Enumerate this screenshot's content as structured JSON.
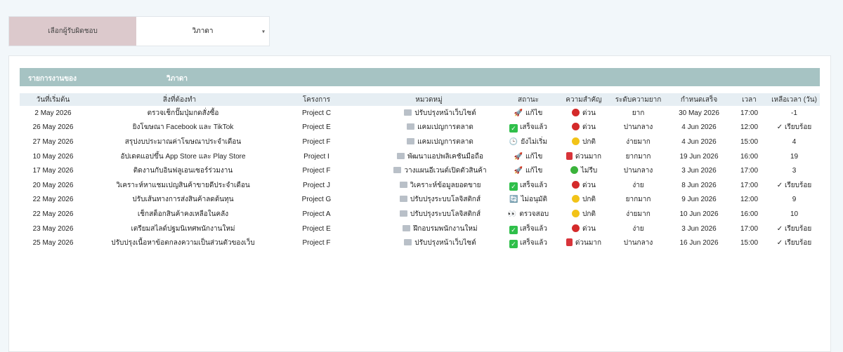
{
  "selector": {
    "label": "เลือกผู้รับผิดชอบ",
    "value": "วิภาดา",
    "caret": "▾"
  },
  "header": {
    "title": "รายการงานของ",
    "name": "วิภาดา",
    "background": "#a6c3c3"
  },
  "columns": {
    "start": "วันที่เริ่มต้น",
    "task": "สิ่งที่ต้องทำ",
    "project": "โครงการ",
    "category": "หมวดหมู่",
    "status": "สถานะ",
    "priority": "ความสำคัญ",
    "difficulty": "ระดับความยาก",
    "due": "กำหนดเสร็จ",
    "time": "เวลา",
    "remaining": "เหลือเวลา (วัน)"
  },
  "rows": [
    {
      "start": "2 May 2026",
      "task": "ตรวจเช็กปั๊มปุ่มกดสั่งซื้อ",
      "project": "Project C",
      "category": "ปรับปรุงหน้าเว็บไซต์",
      "status_icon": "🚀",
      "status": "แก้ไข",
      "priority_icon": "red-circle",
      "priority": "ด่วน",
      "difficulty": "ยาก",
      "due": "30 May 2026",
      "time": "17:00",
      "remaining": "-1"
    },
    {
      "start": "26 May 2026",
      "task": "ยิงโฆษณา Facebook และ TikTok",
      "project": "Project E",
      "category": "แคมเปญการตลาด",
      "status_icon": "check",
      "status": "เสร็จแล้ว",
      "priority_icon": "red-circle",
      "priority": "ด่วน",
      "difficulty": "ปานกลาง",
      "due": "4 Jun 2026",
      "time": "12:00",
      "remaining": "✓ เรียบร้อย"
    },
    {
      "start": "27 May 2026",
      "task": "สรุปงบประมาณค่าโฆษณาประจำเดือน",
      "project": "Project F",
      "category": "แคมเปญการตลาด",
      "status_icon": "🕒",
      "status": "ยังไม่เริ่ม",
      "priority_icon": "yellow-circle",
      "priority": "ปกติ",
      "difficulty": "ง่ายมาก",
      "due": "4 Jun 2026",
      "time": "15:00",
      "remaining": "4"
    },
    {
      "start": "10 May 2026",
      "task": "อัปเดตแอปขึ้น App Store และ Play Store",
      "project": "Project I",
      "category": "พัฒนาแอปพลิเคชันมือถือ",
      "status_icon": "🚀",
      "status": "แก้ไข",
      "priority_icon": "red-square",
      "priority": "ด่วนมาก",
      "difficulty": "ยากมาก",
      "due": "19 Jun 2026",
      "time": "16:00",
      "remaining": "19"
    },
    {
      "start": "17 May 2026",
      "task": "ติดงานกับอินฟลูเอนเซอร์ร่วมงาน",
      "project": "Project F",
      "category": "วางแผนอีเวนต์เปิดตัวสินค้า",
      "status_icon": "🚀",
      "status": "แก้ไข",
      "priority_icon": "green-circle",
      "priority": "ไม่รีบ",
      "difficulty": "ปานกลาง",
      "due": "3 Jun 2026",
      "time": "17:00",
      "remaining": "3"
    },
    {
      "start": "20 May 2026",
      "task": "วิเคราะห์หาแชมเปญสินค้าขายดีประจำเดือน",
      "project": "Project J",
      "category": "วิเคราะห์ข้อมูลยอดขาย",
      "status_icon": "check",
      "status": "เสร็จแล้ว",
      "priority_icon": "red-circle",
      "priority": "ด่วน",
      "difficulty": "ง่าย",
      "due": "8 Jun 2026",
      "time": "17:00",
      "remaining": "✓ เรียบร้อย"
    },
    {
      "start": "22 May 2026",
      "task": "ปรับเส้นทางการส่งสินค้าลดต้นทุน",
      "project": "Project G",
      "category": "ปรับปรุงระบบโลจิสติกส์",
      "status_icon": "🔄",
      "status": "ไม่อนุมัติ",
      "priority_icon": "yellow-circle",
      "priority": "ปกติ",
      "difficulty": "ยากมาก",
      "due": "9 Jun 2026",
      "time": "12:00",
      "remaining": "9"
    },
    {
      "start": "22 May 2026",
      "task": "เช็กสต็อกสินค้าคงเหลือในคลัง",
      "project": "Project A",
      "category": "ปรับปรุงระบบโลจิสติกส์",
      "status_icon": "👀",
      "status": "ตรวจสอบ",
      "priority_icon": "yellow-circle",
      "priority": "ปกติ",
      "difficulty": "ง่ายมาก",
      "due": "10 Jun 2026",
      "time": "16:00",
      "remaining": "10"
    },
    {
      "start": "23 May 2026",
      "task": "เตรียมสไลด์ปฐมนิเทศพนักงานใหม่",
      "project": "Project E",
      "category": "ฝึกอบรมพนักงานใหม่",
      "status_icon": "check",
      "status": "เสร็จแล้ว",
      "priority_icon": "red-circle",
      "priority": "ด่วน",
      "difficulty": "ง่าย",
      "due": "3 Jun 2026",
      "time": "17:00",
      "remaining": "✓ เรียบร้อย"
    },
    {
      "start": "25 May 2026",
      "task": "ปรับปรุงเนื้อหาข้อตกลงความเป็นส่วนตัวของเว็บ",
      "project": "Project F",
      "category": "ปรับปรุงหน้าเว็บไซต์",
      "status_icon": "check",
      "status": "เสร็จแล้ว",
      "priority_icon": "red-square",
      "priority": "ด่วนมาก",
      "difficulty": "ปานกลาง",
      "due": "16 Jun 2026",
      "time": "15:00",
      "remaining": "✓ เรียบร้อย"
    }
  ]
}
